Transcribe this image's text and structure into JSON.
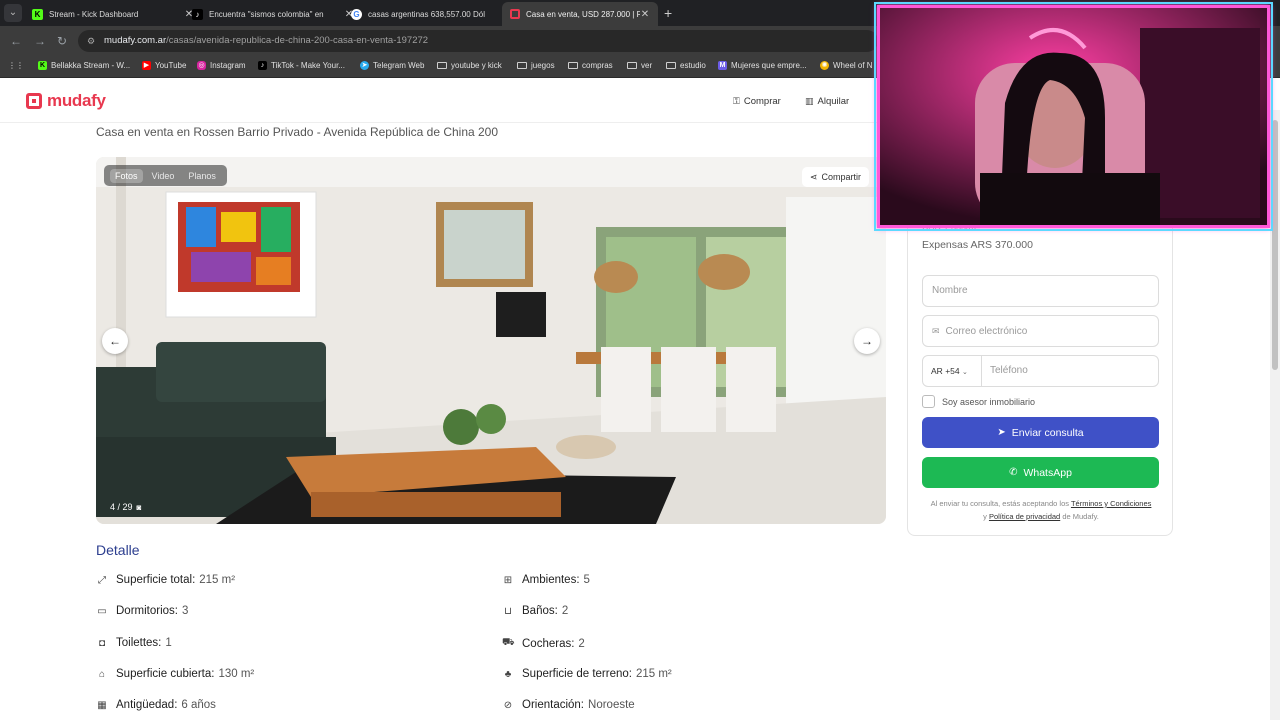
{
  "browser": {
    "tabs": [
      {
        "title": "Stream - Kick Dashboard",
        "favicon": "kick-icon",
        "active": false
      },
      {
        "title": "Encuentra \"sismos colombia\" en",
        "favicon": "tiktok-icon",
        "active": false
      },
      {
        "title": "casas argentinas 638,557.00 Dól",
        "favicon": "google-icon",
        "active": false
      },
      {
        "title": "Casa en venta, USD 287.000 | Ro",
        "favicon": "mudafy-icon",
        "active": true
      }
    ],
    "url_site": "mudafy.com.ar",
    "url_path": "/casas/avenida-republica-de-china-200-casa-en-venta-197272",
    "bookmarks": [
      {
        "label": "Bellakka Stream - W...",
        "icon": "kick-icon"
      },
      {
        "label": "YouTube",
        "icon": "youtube-icon"
      },
      {
        "label": "Instagram",
        "icon": "instagram-icon"
      },
      {
        "label": "TikTok - Make Your...",
        "icon": "tiktok-icon"
      },
      {
        "label": "Telegram Web",
        "icon": "telegram-icon"
      },
      {
        "label": "youtube y kick",
        "icon": "folder-icon"
      },
      {
        "label": "juegos",
        "icon": "folder-icon"
      },
      {
        "label": "compras",
        "icon": "folder-icon"
      },
      {
        "label": "ver",
        "icon": "folder-icon"
      },
      {
        "label": "estudio",
        "icon": "folder-icon"
      },
      {
        "label": "Mujeres que empre...",
        "icon": "m-icon"
      },
      {
        "label": "Wheel of N",
        "icon": "wheel-icon"
      }
    ]
  },
  "site": {
    "logo": "mudafy",
    "nav": [
      {
        "label": "Comprar",
        "icon": "key-icon"
      },
      {
        "label": "Alquilar",
        "icon": "building-icon"
      }
    ],
    "brand_color": "#e8384f"
  },
  "listing": {
    "subtitle": "Casa en venta en Rossen Barrio Privado - Avenida República de China 200",
    "gallery_tabs": [
      "Fotos",
      "Video",
      "Planos"
    ],
    "share_label": "Compartir",
    "photo_counter": "4 / 29",
    "detalle_title": "Detalle",
    "features_left": [
      {
        "label": "Superficie total:",
        "value": "215 m²",
        "icon": "expand-icon"
      },
      {
        "label": "Dormitorios:",
        "value": "3",
        "icon": "bed-icon"
      },
      {
        "label": "Toilettes:",
        "value": "1",
        "icon": "toilet-icon"
      },
      {
        "label": "Superficie cubierta:",
        "value": "130 m²",
        "icon": "house-icon"
      },
      {
        "label": "Antigüedad:",
        "value": "6 años",
        "icon": "calendar-icon"
      }
    ],
    "features_right": [
      {
        "label": "Ambientes:",
        "value": "5",
        "icon": "grid-icon"
      },
      {
        "label": "Baños:",
        "value": "2",
        "icon": "bath-icon"
      },
      {
        "label": "Cocheras:",
        "value": "2",
        "icon": "car-icon"
      },
      {
        "label": "Superficie de terreno:",
        "value": "215 m²",
        "icon": "plant-icon"
      },
      {
        "label": "Orientación:",
        "value": "Noroeste",
        "icon": "compass-icon"
      }
    ]
  },
  "contact": {
    "usd_partial": "USD 1.335/m²",
    "expensas": "Expensas ARS 370.000",
    "name_placeholder": "Nombre",
    "email_placeholder": "Correo electrónico",
    "phone_country": "AR",
    "phone_code": "+54",
    "phone_placeholder": "Teléfono",
    "agent_checkbox_label": "Soy asesor inmobiliario",
    "send_button": "Enviar consulta",
    "whatsapp_button": "WhatsApp",
    "terms_prefix": "Al enviar tu consulta, estás aceptando los",
    "terms_link": "Términos y Condiciones",
    "terms_mid": "y",
    "privacy_link": "Política de privacidad",
    "terms_suffix": "de Mudafy.",
    "send_color": "#3f51c7",
    "whatsapp_color": "#1db954"
  }
}
